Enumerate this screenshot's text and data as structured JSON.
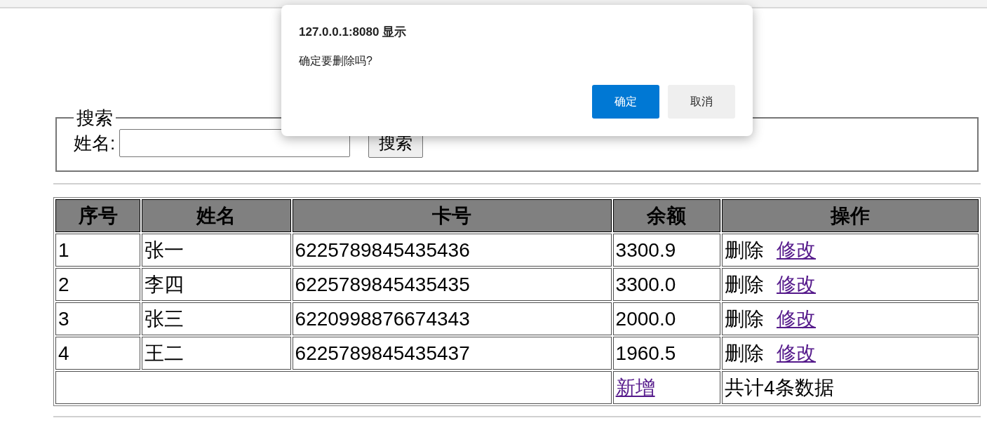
{
  "dialog": {
    "title": "127.0.0.1:8080 显示",
    "message": "确定要删除吗?",
    "buttons": [
      {
        "label": "确定",
        "kind": "primary"
      },
      {
        "label": "取消",
        "kind": "secondary"
      }
    ]
  },
  "search": {
    "legend": "搜索",
    "label": "姓名:",
    "button": "搜索"
  },
  "table": {
    "columns": [
      "序号",
      "姓名",
      "卡号",
      "余额",
      "操作"
    ],
    "rows": [
      {
        "cells": [
          "1",
          "张一",
          "6225789845435436",
          "3300.9"
        ],
        "actions": [
          {
            "label": "删除",
            "kind": "text"
          },
          {
            "label": "修改",
            "kind": "link"
          }
        ]
      },
      {
        "cells": [
          "2",
          "李四",
          "6225789845435435",
          "3300.0"
        ],
        "actions": [
          {
            "label": "删除",
            "kind": "text"
          },
          {
            "label": "修改",
            "kind": "link"
          }
        ]
      },
      {
        "cells": [
          "3",
          "张三",
          "6220998876674343",
          "2000.0"
        ],
        "actions": [
          {
            "label": "删除",
            "kind": "text"
          },
          {
            "label": "修改",
            "kind": "link"
          }
        ]
      },
      {
        "cells": [
          "4",
          "王二",
          "6225789845435437",
          "1960.5"
        ],
        "actions": [
          {
            "label": "删除",
            "kind": "text"
          },
          {
            "label": "修改",
            "kind": "link"
          }
        ]
      }
    ],
    "footer": {
      "add_link": "新增",
      "total": "共计4条数据"
    }
  }
}
